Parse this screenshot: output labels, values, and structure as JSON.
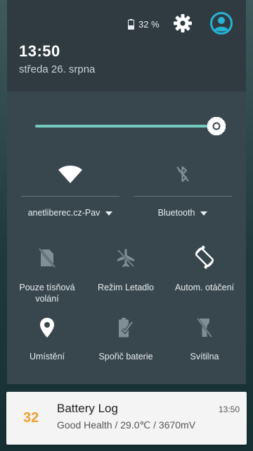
{
  "status": {
    "battery_percent": "32 %",
    "icons": [
      "battery-icon",
      "settings-gear-icon",
      "account-icon"
    ]
  },
  "header": {
    "time": "13:50",
    "date": "středa 26. srpna"
  },
  "brightness": {
    "level": 0.86,
    "icon": "brightness-icon"
  },
  "tiles_large": [
    {
      "label": "anetliberec.cz-Pav",
      "icon": "wifi-icon",
      "active": true
    },
    {
      "label": "Bluetooth",
      "icon": "bluetooth-off-icon",
      "active": false
    }
  ],
  "tiles": [
    {
      "label": "Pouze tísňová volání",
      "icon": "no-sim-icon"
    },
    {
      "label": "Režim Letadlo",
      "icon": "airplane-icon"
    },
    {
      "label": "Autom. otáčení",
      "icon": "auto-rotate-icon"
    },
    {
      "label": "Umístění",
      "icon": "location-icon"
    },
    {
      "label": "Spořič baterie",
      "icon": "battery-saver-icon"
    },
    {
      "label": "Svítilna",
      "icon": "flashlight-icon"
    }
  ],
  "notification": {
    "badge": "32",
    "title": "Battery Log",
    "text": "Good Health / 29.0℃ / 3670mV",
    "time": "13:50"
  },
  "colors": {
    "accent": "#76c9c2",
    "account": "#25b4d6",
    "panel": "#38474d",
    "header": "#2f3b40",
    "notification_badge": "#f0a030"
  }
}
